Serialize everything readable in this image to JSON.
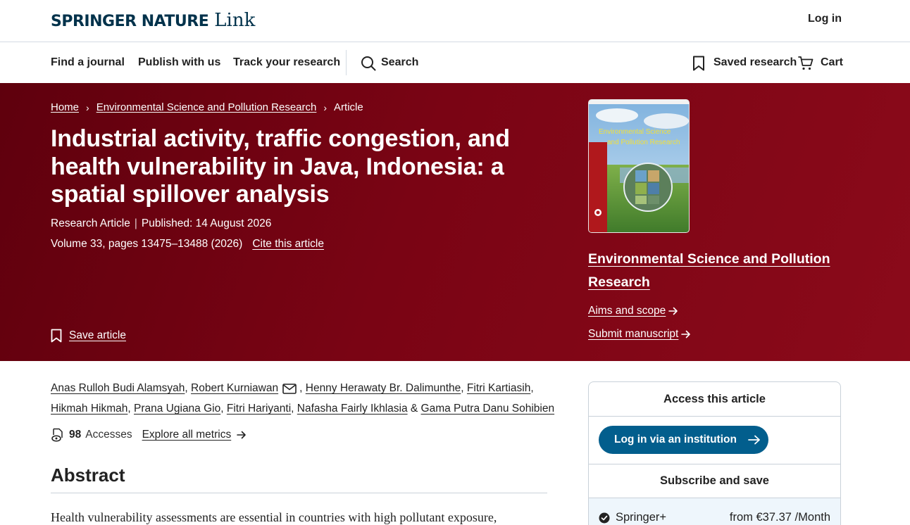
{
  "header": {
    "logo_main": "SPRINGER NATURE",
    "logo_link": "Link",
    "login": "Log in"
  },
  "nav": {
    "find_journal": "Find a journal",
    "publish": "Publish with us",
    "track": "Track your research",
    "search": "Search",
    "saved": "Saved research",
    "cart": "Cart"
  },
  "breadcrumb": {
    "home": "Home",
    "journal": "Environmental Science and Pollution Research",
    "current": "Article"
  },
  "article": {
    "title": "Industrial activity, traffic congestion, and health vulnerability in Java, Indonesia: a spatial spillover analysis",
    "type": "Research Article",
    "published": "Published: 14 August 2026",
    "volume": "Volume 33, pages 13475–13488 (2026)",
    "cite": "Cite this article",
    "save": "Save article"
  },
  "journal": {
    "name": "Environmental Science and Pollution Research",
    "aims": "Aims and scope",
    "submit": "Submit manuscript",
    "cover_title_1": "Environmental Science",
    "cover_title_2": "and Pollution Research"
  },
  "authors": {
    "a1": "Anas Rulloh Budi Alamsyah",
    "a2": "Robert Kurniawan",
    "a3": "Henny Herawaty Br. Dalimunthe",
    "a4": "Fitri Kartiasih",
    "a5": "Hikmah Hikmah",
    "a6": "Prana Ugiana Gio",
    "a7": "Fitri Hariyanti",
    "a8": "Nafasha Fairly Ikhlasia",
    "a9": "Gama Putra Danu Sohibien"
  },
  "metrics": {
    "count": "98",
    "label": "Accesses",
    "explore": "Explore all metrics"
  },
  "abstract": {
    "heading": "Abstract",
    "text": "Health vulnerability assessments are essential in countries with high pollutant exposure,"
  },
  "access": {
    "heading": "Access this article",
    "login_btn": "Log in via an institution",
    "subscribe": "Subscribe and save",
    "plan": "Springer+",
    "price": "from €37.37 /Month"
  },
  "colors": {
    "brand_navy": "#01324b",
    "hero_red": "#7a0414",
    "button_blue": "#025e8d"
  }
}
